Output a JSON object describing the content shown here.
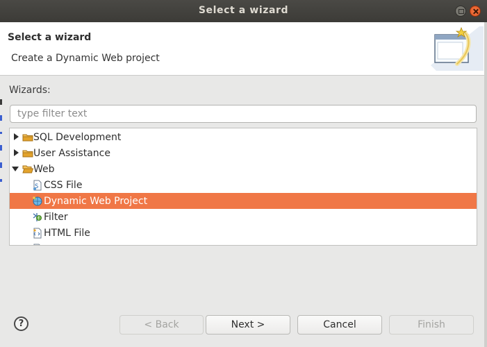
{
  "window": {
    "title": "Select a wizard"
  },
  "header": {
    "title": "Select a wizard",
    "description": "Create a Dynamic Web project",
    "icon": "wizard-banner-icon"
  },
  "wizards": {
    "label": "Wizards:",
    "filter_placeholder": "type filter text",
    "filter_value": ""
  },
  "tree": {
    "items": [
      {
        "label": "SQL Development",
        "state": "collapsed",
        "icon": "folder-icon"
      },
      {
        "label": "User Assistance",
        "state": "collapsed",
        "icon": "folder-icon"
      },
      {
        "label": "Web",
        "state": "expanded",
        "icon": "folder-open-icon"
      },
      {
        "label": "CSS File",
        "icon": "css-file-icon"
      },
      {
        "label": "Dynamic Web Project",
        "icon": "web-project-icon",
        "selected": true
      },
      {
        "label": "Filter",
        "icon": "filter-icon"
      },
      {
        "label": "HTML File",
        "icon": "html-file-icon"
      }
    ]
  },
  "footer": {
    "help_label": "?",
    "back_label": "< Back",
    "next_label": "Next >",
    "cancel_label": "Cancel",
    "finish_label": "Finish"
  },
  "colors": {
    "titlebar": "#3c3b37",
    "selection": "#f07746",
    "close_button": "#e0561f",
    "folder": "#e3a32c"
  }
}
